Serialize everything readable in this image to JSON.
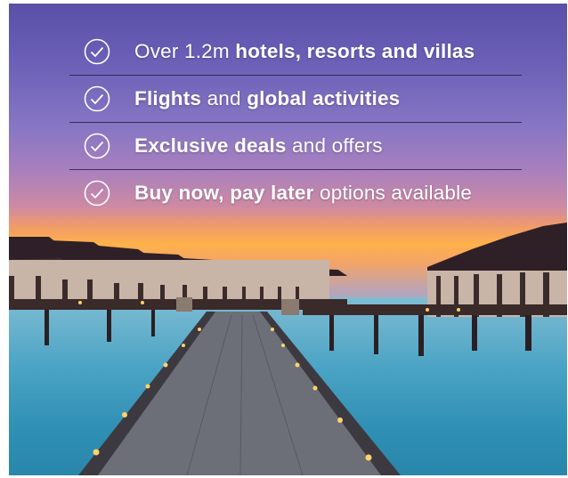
{
  "features": [
    {
      "pre": "Over 1.2m ",
      "bold": "hotels, resorts and villas",
      "post": ""
    },
    {
      "pre": "",
      "bold": "Flights",
      "post": " and ",
      "bold2": "global activities"
    },
    {
      "pre": "",
      "bold": "Exclusive deals",
      "post": " and offers"
    },
    {
      "pre": "",
      "bold": "Buy now, pay later",
      "post": " options available"
    }
  ],
  "icons": {
    "check": "check-circle-icon"
  },
  "colors": {
    "text": "#ffffff",
    "divider": "#1e1432"
  }
}
